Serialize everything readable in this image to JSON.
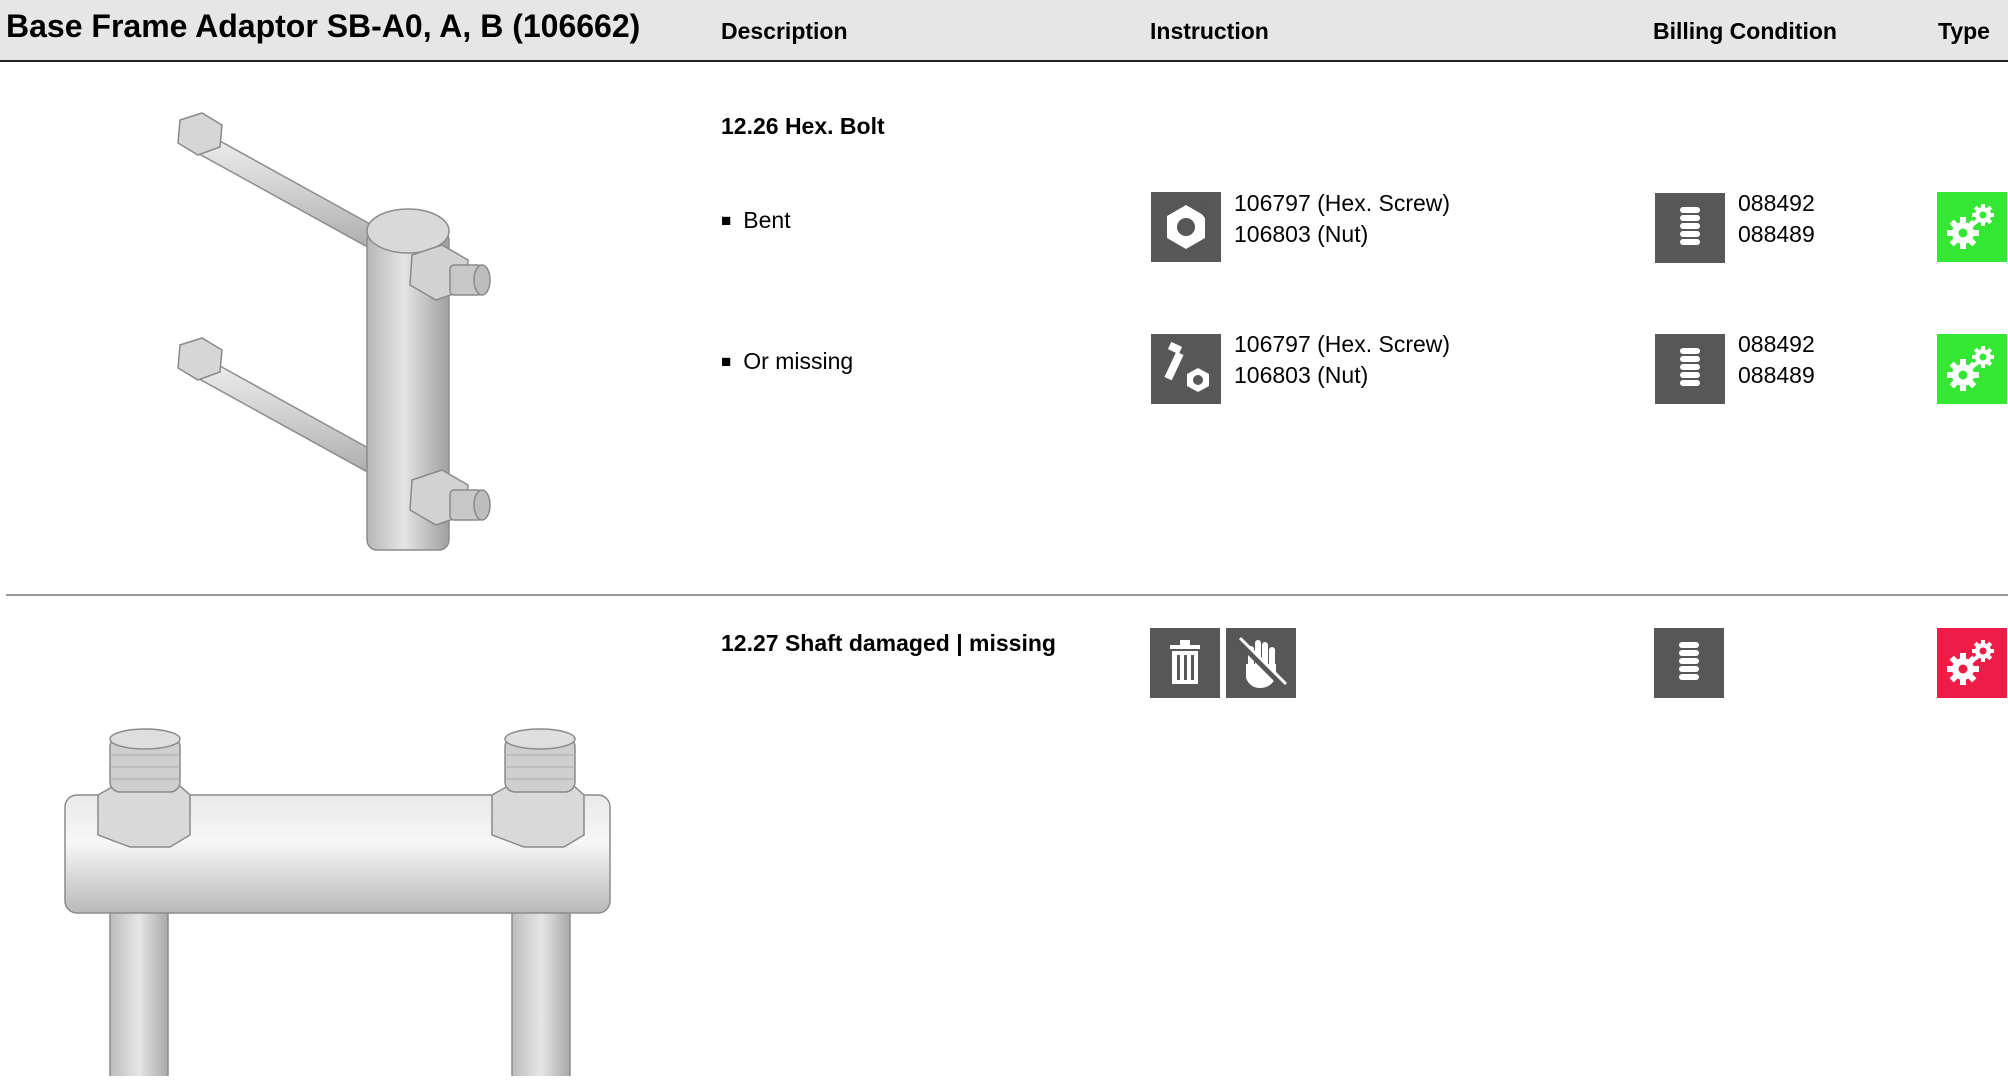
{
  "header": {
    "title": "Base Frame Adaptor SB-A0, A, B (106662)",
    "col_description": "Description",
    "col_instruction": "Instruction",
    "col_billing": "Billing Condition",
    "col_type": "Type"
  },
  "sections": [
    {
      "title": "12.26 Hex. Bolt",
      "rows": [
        {
          "bullet": "Bent",
          "instruction_icon": "damaged-nut-icon",
          "instruction_lines": [
            "106797 (Hex. Screw)",
            "106803 (Nut)"
          ],
          "billing_icon": "coin-stack-icon",
          "billing_lines": [
            "088492",
            "088489"
          ],
          "type_icon": "gears-icon",
          "type_color": "#33e733"
        },
        {
          "bullet": "Or missing",
          "instruction_icon": "bolt-and-nut-icon",
          "instruction_lines": [
            "106797 (Hex. Screw)",
            "106803 (Nut)"
          ],
          "billing_icon": "coin-stack-icon",
          "billing_lines": [
            "088492",
            "088489"
          ],
          "type_icon": "gears-icon",
          "type_color": "#33e733"
        }
      ]
    },
    {
      "title": "12.27 Shaft damaged | missing",
      "instruction_icons": [
        "trash-icon",
        "no-touch-hand-icon"
      ],
      "billing_icon": "coin-stack-icon",
      "type_icon": "gears-icon",
      "type_color": "#ee1c46"
    }
  ],
  "colors": {
    "icon_bg": "#575757",
    "header_bg": "#e6e6e6"
  }
}
